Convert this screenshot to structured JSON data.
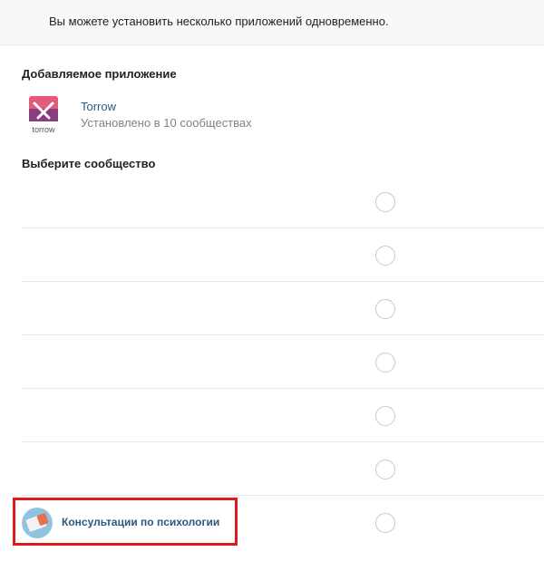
{
  "notice": {
    "text": "Вы можете установить несколько приложений одновременно."
  },
  "added_app": {
    "heading": "Добавляемое приложение",
    "name": "Torrow",
    "installs": "Установлено в 10 сообществах",
    "logo_caption": "torrow",
    "logo_icon": "torrow-logo-icon",
    "accent_color": "#8a3d7c"
  },
  "select": {
    "heading": "Выберите сообщество"
  },
  "communities": [
    {
      "name": ""
    },
    {
      "name": ""
    },
    {
      "name": ""
    },
    {
      "name": ""
    },
    {
      "name": ""
    },
    {
      "name": ""
    },
    {
      "name": "Консультации по психологии"
    }
  ],
  "colors": {
    "link": "#2a5885",
    "highlight_border": "#e01a1a",
    "muted": "#828282"
  }
}
